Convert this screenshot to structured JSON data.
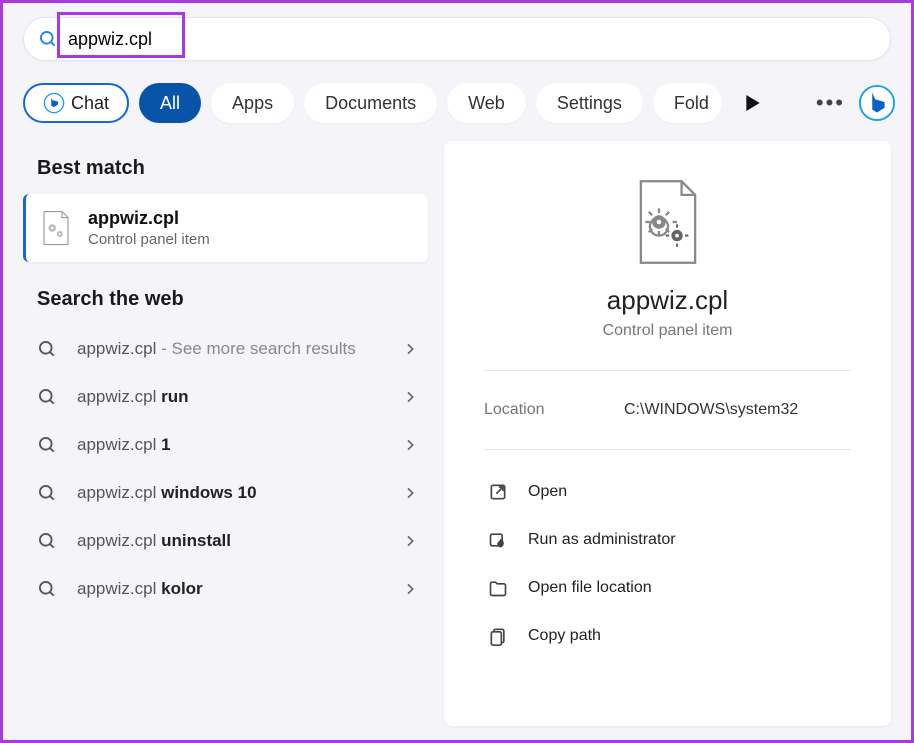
{
  "search": {
    "query": "appwiz.cpl"
  },
  "tabs": {
    "chat": "Chat",
    "filters": [
      "All",
      "Apps",
      "Documents",
      "Web",
      "Settings",
      "Fold"
    ],
    "active_index": 0,
    "more": "..."
  },
  "sections": {
    "best_match": "Best match",
    "search_web": "Search the web"
  },
  "best": {
    "title": "appwiz.cpl",
    "subtitle": "Control panel item"
  },
  "web_results": [
    {
      "prefix": "appwiz.cpl",
      "bold": " - See more search results"
    },
    {
      "prefix": "appwiz.cpl ",
      "bold": "run"
    },
    {
      "prefix": "appwiz.cpl ",
      "bold": "1"
    },
    {
      "prefix": "appwiz.cpl ",
      "bold": "windows 10"
    },
    {
      "prefix": "appwiz.cpl ",
      "bold": "uninstall"
    },
    {
      "prefix": "appwiz.cpl ",
      "bold": "kolor"
    }
  ],
  "preview": {
    "title": "appwiz.cpl",
    "subtitle": "Control panel item",
    "location_label": "Location",
    "location_value": "C:\\WINDOWS\\system32"
  },
  "actions": {
    "open": "Open",
    "run_admin": "Run as administrator",
    "open_loc": "Open file location",
    "copy_path": "Copy path"
  }
}
